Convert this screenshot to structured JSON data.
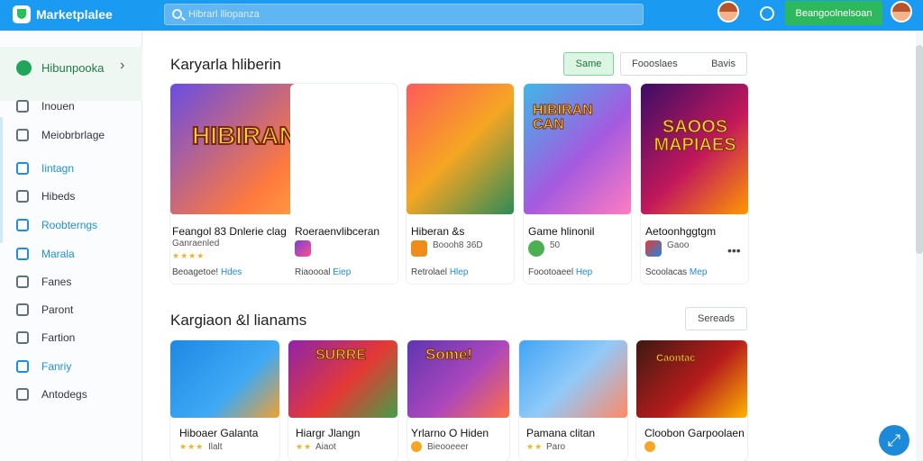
{
  "app": {
    "title": "Marketplalee"
  },
  "search": {
    "placeholder": "Hibrarl lliopanza"
  },
  "top_cta": "Beangoolnelsoan",
  "sidebar": {
    "header": "Hibunpooka",
    "items": [
      {
        "label": "Inouen"
      },
      {
        "label": "Meiobrbrlage"
      },
      {
        "label": "Iintagn"
      },
      {
        "label": "Hibeds"
      },
      {
        "label": "Roobterngs"
      },
      {
        "label": "Marala"
      },
      {
        "label": "Fanes"
      },
      {
        "label": "Paront"
      },
      {
        "label": "Fartion"
      },
      {
        "label": "Fanriy"
      },
      {
        "label": "Antodegs"
      }
    ]
  },
  "section1": {
    "title": "Karyarla hliberin",
    "buttons": [
      "Same",
      "Foooslaes",
      "Bavis"
    ],
    "cards": [
      {
        "name": "Feangol 83 Dnlerie clag",
        "sub": "Ganraenled",
        "footer_a": "Beoagetoe!",
        "footer_b": "Hdes",
        "stars": "★★★★"
      },
      {
        "name": "Roeraenvlibceran",
        "sub": "",
        "footer_a": "Riaoooal",
        "footer_b": "Eiep",
        "stars": ""
      },
      {
        "name": "Hiberan &s",
        "sub": "Boooh8 36D",
        "footer_a": "Retrolael",
        "footer_b": "Hlep",
        "stars": ""
      },
      {
        "name": "Game hlinonil",
        "sub": "50",
        "footer_a": "Foootoaeel",
        "footer_b": "Hep",
        "stars": ""
      },
      {
        "name": "Aetoonhggtgm",
        "sub": "Gaoo",
        "footer_a": "Scoolacas",
        "footer_b": "Mep",
        "stars": ""
      }
    ]
  },
  "section2": {
    "title": "Kargiaon &l lianams",
    "button": "Sereads",
    "cards": [
      {
        "name": "Hiboaer Galanta",
        "stars": "★★★",
        "sub": "Ilalt"
      },
      {
        "name": "Hiargr Jlangn",
        "stars": "★★",
        "sub": "Aiaot"
      },
      {
        "name": "Yrlarno O Hiden",
        "stars": "",
        "sub": "Bieooeeer"
      },
      {
        "name": "Pamana clitan",
        "stars": "★★",
        "sub": "Paro"
      },
      {
        "name": "Cloobon Garpoolaen",
        "stars": "",
        "sub": ""
      }
    ]
  },
  "thumbnail_texts": [
    "HIBIRAN SODAK",
    "HIBIRAN CAN",
    "SAOOS MAPIAES",
    "SURRE",
    "Some!",
    "Caontac"
  ]
}
